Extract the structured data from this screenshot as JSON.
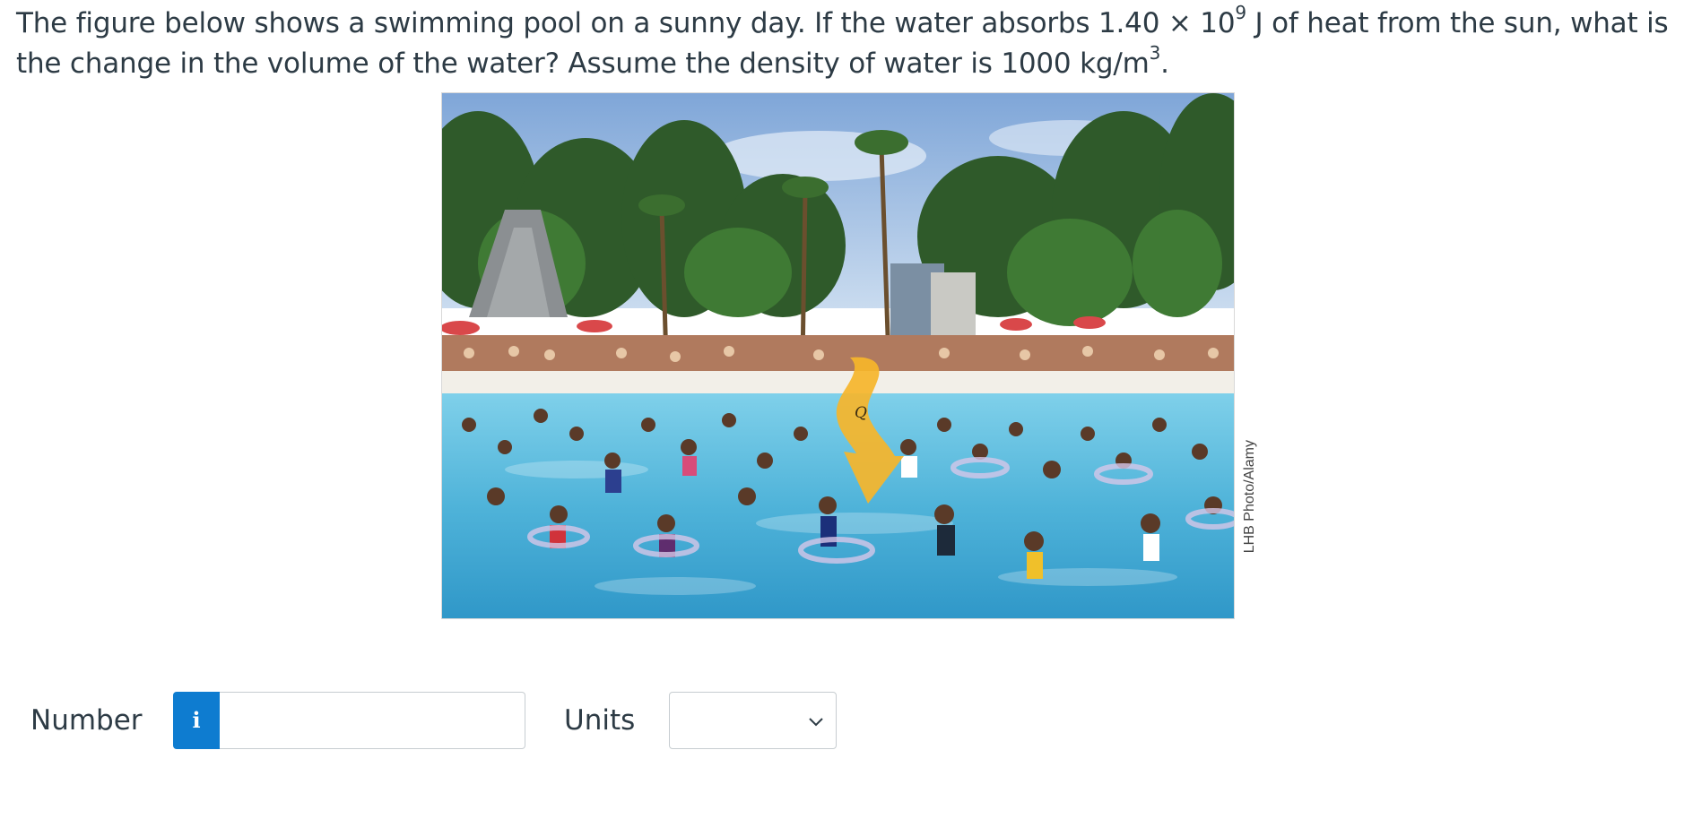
{
  "question": {
    "text_before_exp1": "The figure below shows a swimming pool on a sunny day. If the water absorbs 1.40 × 10",
    "exp1": "9",
    "text_mid": " J of heat from the sun, what is the change in the volume of the water?  Assume the density of water is 1000 kg/m",
    "exp2": "3",
    "text_end": "."
  },
  "figure": {
    "heat_label": "Q",
    "credit": "LHB Photo/Alamy"
  },
  "answer": {
    "number_label": "Number",
    "info_icon": "i",
    "number_value": "",
    "units_label": "Units",
    "units_selected": ""
  },
  "colors": {
    "text": "#2d3b45",
    "info_button": "#0e7cd0",
    "water": "#4fb3d9",
    "arrow": "#f6b52a"
  },
  "icons": {
    "info": "info-icon",
    "dropdown": "chevron-down-icon",
    "heat_arrow": "heat-arrow-icon"
  }
}
